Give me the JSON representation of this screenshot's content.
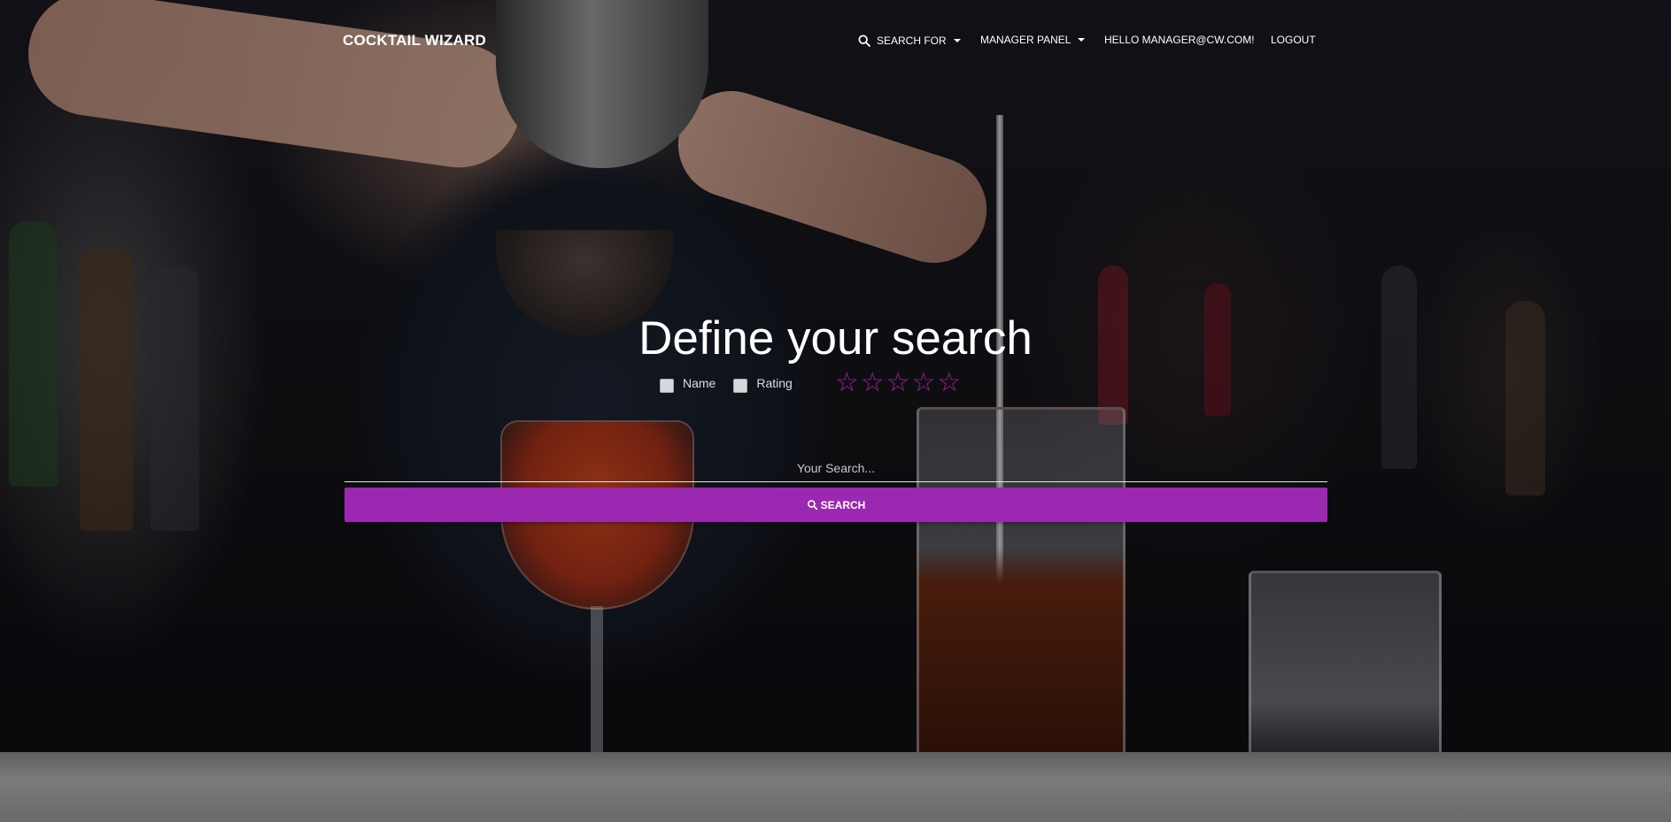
{
  "navbar": {
    "brand": "COCKTAIL WIZARD",
    "search_for": {
      "label": "SEARCH FOR",
      "icon": "search-icon"
    },
    "manager_panel": {
      "label": "MANAGER PANEL"
    },
    "greeting": "HELLO MANAGER@CW.COM!",
    "logout": "LOGOUT"
  },
  "hero": {
    "title": "Define your search",
    "options": [
      {
        "label": "Name",
        "checked": false
      },
      {
        "label": "Rating",
        "checked": false
      }
    ],
    "rating": {
      "stars": 5,
      "selected": 0,
      "color": "#a0209a"
    },
    "search_input": {
      "placeholder": "Your Search...",
      "value": ""
    },
    "search_button": {
      "label": "SEARCH",
      "icon": "search-icon",
      "color": "#9c27b0"
    }
  }
}
